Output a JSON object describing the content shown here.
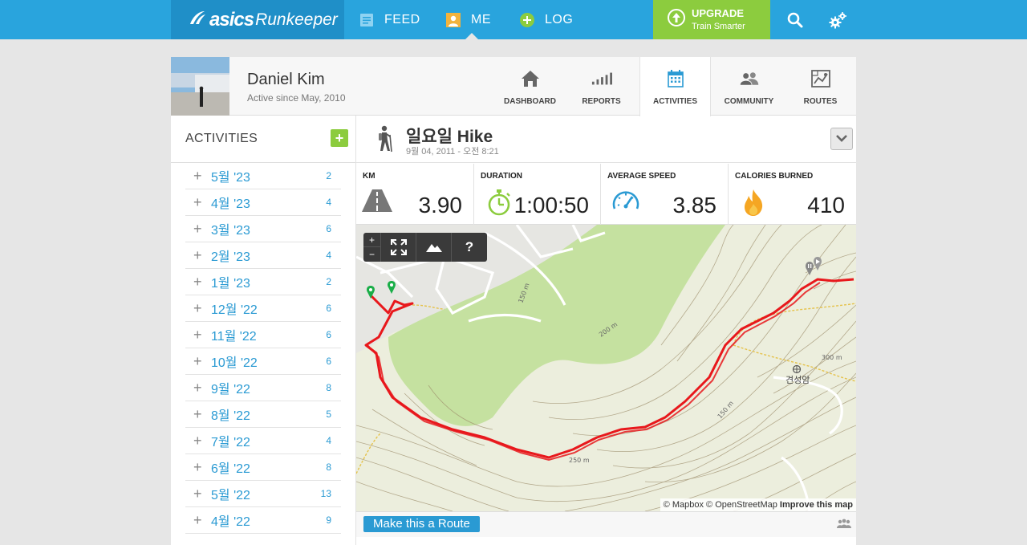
{
  "topnav": {
    "logo_brand": "asics",
    "logo_name": "Runkeeper",
    "items": [
      {
        "label": "FEED",
        "icon": "feed-icon"
      },
      {
        "label": "ME",
        "icon": "me-icon"
      },
      {
        "label": "LOG",
        "icon": "log-plus-icon"
      }
    ],
    "upgrade_title": "UPGRADE",
    "upgrade_sub": "Train Smarter",
    "colors": {
      "bar": "#29a4dd",
      "logo_bg": "#1f8fc8",
      "upgrade": "#8ccc3e"
    }
  },
  "profile": {
    "name": "Daniel Kim",
    "since": "Active since May, 2010"
  },
  "tabs": [
    {
      "label": "DASHBOARD",
      "icon": "home-icon"
    },
    {
      "label": "REPORTS",
      "icon": "bar-chart-icon"
    },
    {
      "label": "ACTIVITIES",
      "icon": "calendar-icon",
      "active": true
    },
    {
      "label": "COMMUNITY",
      "icon": "people-icon"
    },
    {
      "label": "ROUTES",
      "icon": "map-icon"
    }
  ],
  "sidebar": {
    "title": "ACTIVITIES",
    "add_label": "+",
    "months": [
      {
        "label": "5월 '23",
        "count": "2"
      },
      {
        "label": "4월 '23",
        "count": "4"
      },
      {
        "label": "3월 '23",
        "count": "6"
      },
      {
        "label": "2월 '23",
        "count": "4"
      },
      {
        "label": "1월 '23",
        "count": "2"
      },
      {
        "label": "12월 '22",
        "count": "6"
      },
      {
        "label": "11월 '22",
        "count": "6"
      },
      {
        "label": "10월 '22",
        "count": "6"
      },
      {
        "label": "9월 '22",
        "count": "8"
      },
      {
        "label": "8월 '22",
        "count": "5"
      },
      {
        "label": "7월 '22",
        "count": "4"
      },
      {
        "label": "6월 '22",
        "count": "8"
      },
      {
        "label": "5월 '22",
        "count": "13"
      },
      {
        "label": "4월 '22",
        "count": "9"
      }
    ]
  },
  "activity": {
    "title": "일요일 Hike",
    "date": "9월 04, 2011  -  오전 8:21"
  },
  "stats": [
    {
      "label": "KM",
      "value": "3.90",
      "icon": "road-icon"
    },
    {
      "label": "DURATION",
      "value": "1:00:50",
      "icon": "stopwatch-icon"
    },
    {
      "label": "AVERAGE SPEED",
      "value": "3.85",
      "icon": "speedometer-icon"
    },
    {
      "label": "CALORIES BURNED",
      "value": "410",
      "icon": "flame-icon"
    }
  ],
  "map": {
    "zoom_in": "+",
    "zoom_out": "−",
    "help": "?",
    "place_label": "견성암",
    "contour_labels": [
      "150 m",
      "200 m",
      "250 m",
      "300 m",
      "150 m"
    ],
    "attribution_mapbox": "© Mapbox",
    "attribution_osm": "© OpenStreetMap",
    "attribution_improve": "Improve this map",
    "route_color": "#e8181c"
  },
  "bottom": {
    "route_button": "Make this a Route"
  }
}
